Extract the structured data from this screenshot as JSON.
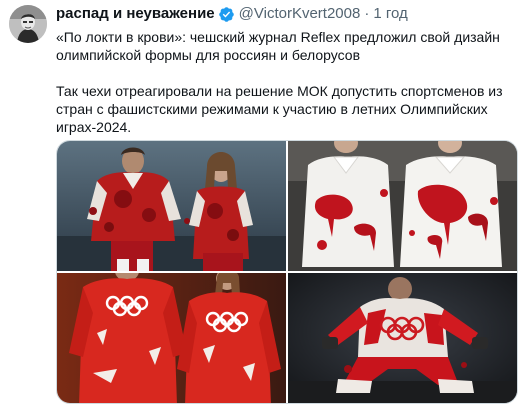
{
  "author": {
    "display_name": "распад и неуважение",
    "handle": "@VictorKvert2008",
    "separator": "·",
    "time": "1 год"
  },
  "tweet": {
    "paragraph_1": "«По локти в крови»: чешский журнал Reflex предложил свой дизайн олимпийской формы для россиян и белорусов",
    "paragraph_2": "Так чехи отреагировали на решение МОК допустить спортсменов из стран с фашистскими режимами к участию в летних Олимпийских играх-2024."
  },
  "colors": {
    "verified": "#1d9bf0",
    "text": "#0f1419",
    "secondary": "#536471",
    "blood_red": "#b5111b"
  },
  "icons": {
    "verified": "verified-badge-icon"
  },
  "media": {
    "count": 4
  }
}
